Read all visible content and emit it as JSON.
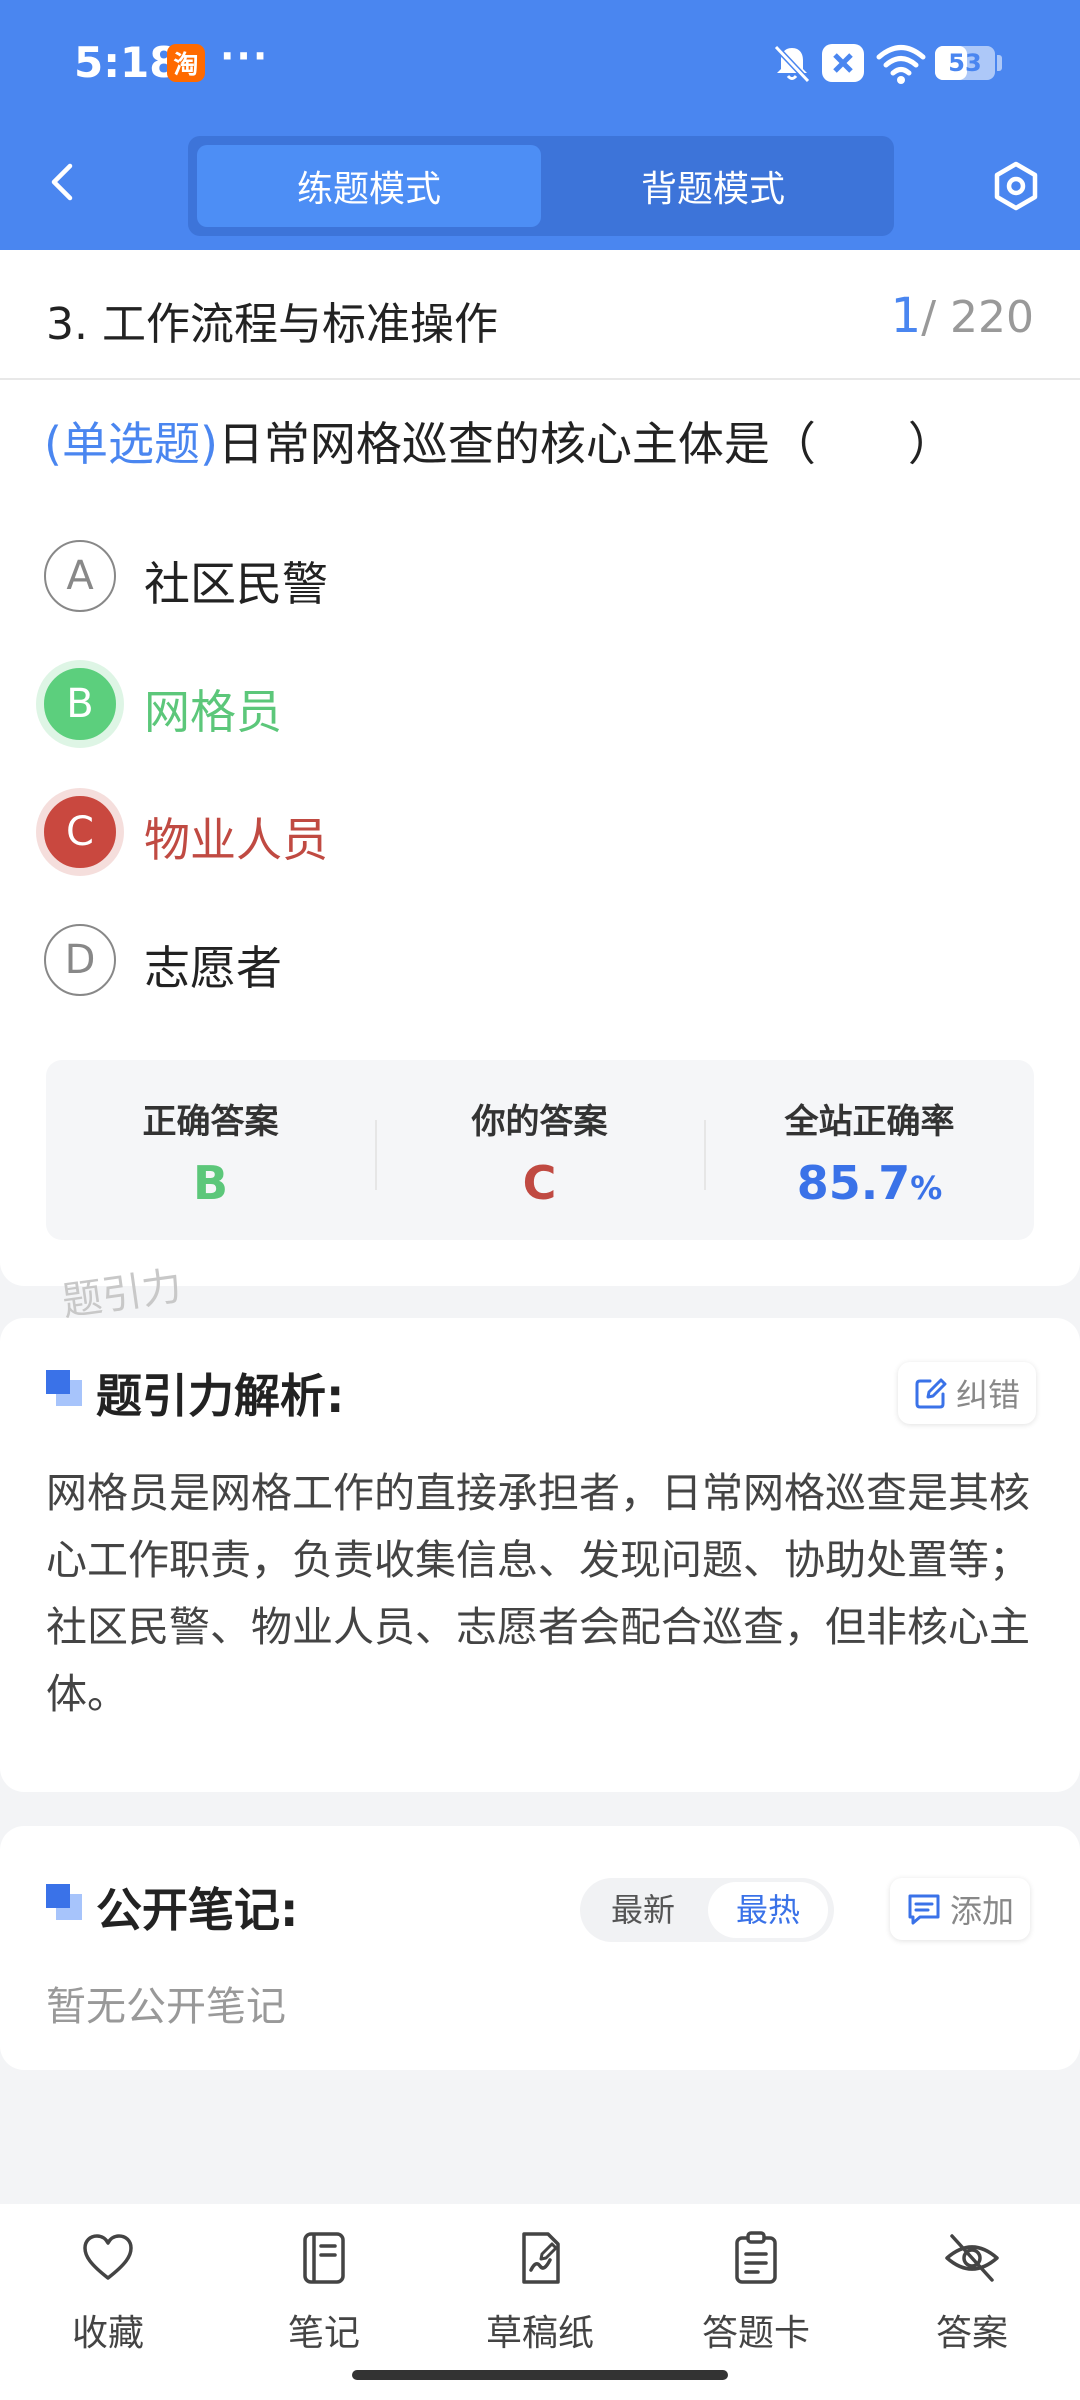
{
  "status_bar": {
    "time": "5:18",
    "app_badge": "淘",
    "more_dots": "···",
    "battery_level": "53",
    "battery_fraction": 0.53,
    "icons": [
      "taobao-icon",
      "more-dots-icon",
      "bell-mute-icon",
      "x-icon",
      "wifi-icon",
      "battery-icon"
    ]
  },
  "header": {
    "modes": [
      "练题模式",
      "背题模式"
    ],
    "active_mode": "练题模式"
  },
  "question": {
    "chapter": "3. 工作流程与标准操作",
    "current": "1",
    "total": "/ 220",
    "type_label": "(单选题)",
    "stem": "日常网格巡查的核心主体是（　　）",
    "options": [
      {
        "letter": "A",
        "text": "社区民警",
        "state": "normal"
      },
      {
        "letter": "B",
        "text": "网格员",
        "state": "correct"
      },
      {
        "letter": "C",
        "text": "物业人员",
        "state": "wrong"
      },
      {
        "letter": "D",
        "text": "志愿者",
        "state": "normal"
      }
    ]
  },
  "answer_stats": {
    "correct_label": "正确答案",
    "correct_value": "B",
    "yours_label": "你的答案",
    "yours_value": "C",
    "rate_label": "全站正确率",
    "rate_value": "85.7",
    "rate_unit": "%"
  },
  "watermark": "题引力",
  "analysis": {
    "title": "题引力解析:",
    "report_button": "纠错",
    "text": "网格员是网格工作的直接承担者，日常网格巡查是其核心工作职责，负责收集信息、发现问题、协助处置等；社区民警、物业人员、志愿者会配合巡查，但非核心主体。"
  },
  "notes": {
    "title": "公开笔记:",
    "sort_latest": "最新",
    "sort_hottest": "最热",
    "active_sort": "最热",
    "add_button": "添加",
    "empty_text": "暂无公开笔记"
  },
  "bottom_nav": [
    {
      "label": "收藏",
      "icon": "heart-icon"
    },
    {
      "label": "笔记",
      "icon": "notebook-icon"
    },
    {
      "label": "草稿纸",
      "icon": "draft-paper-icon"
    },
    {
      "label": "答题卡",
      "icon": "answer-sheet-icon"
    },
    {
      "label": "答案",
      "icon": "eye-off-icon"
    }
  ],
  "colors": {
    "brand": "#4a86f0",
    "correct": "#5ccf7d",
    "wrong": "#c9483f"
  }
}
